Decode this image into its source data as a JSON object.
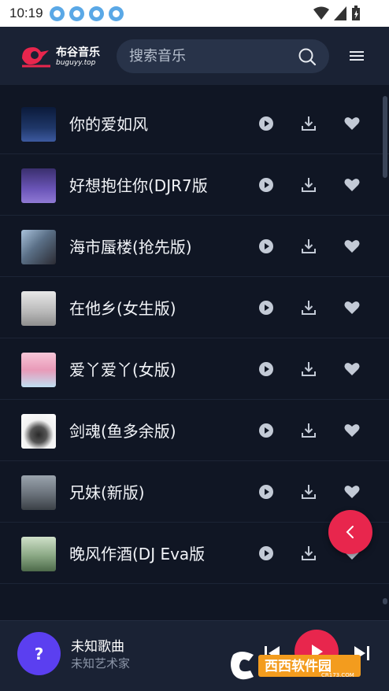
{
  "status_bar": {
    "time": "10:19"
  },
  "header": {
    "brand_name": "布谷音乐",
    "brand_url": "buguyy.top",
    "search_placeholder": "搜索音乐"
  },
  "songs": [
    {
      "title": "你的爱如风"
    },
    {
      "title": "好想抱住你(DJR7版"
    },
    {
      "title": "海市蜃楼(抢先版)"
    },
    {
      "title": "在他乡(女生版)"
    },
    {
      "title": "爱丫爱丫(女版)"
    },
    {
      "title": "剑魂(鱼多余版)"
    },
    {
      "title": "兄妹(新版)"
    },
    {
      "title": "晚风作酒(DJ Eva版"
    }
  ],
  "player": {
    "avatar_text": "?",
    "title": "未知歌曲",
    "artist": "未知艺术家"
  },
  "watermark": {
    "text": "西西软件园",
    "url": "CR173.COM"
  },
  "colors": {
    "background": "#101624",
    "header": "#1a2234",
    "accent": "#e8264d",
    "avatar": "#5b3ff0"
  }
}
